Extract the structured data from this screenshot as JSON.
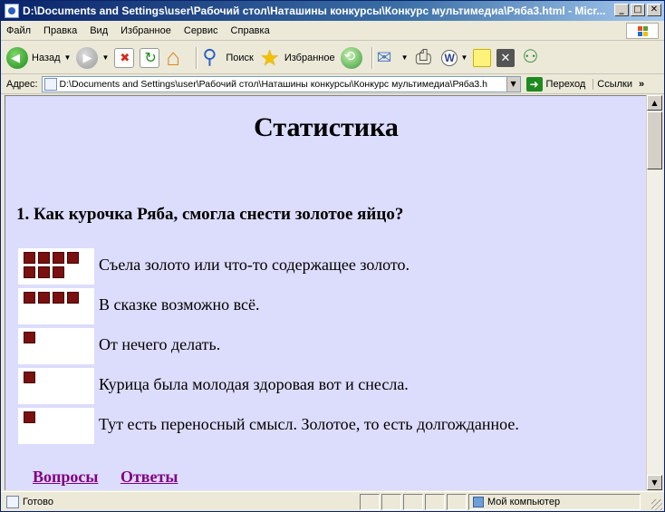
{
  "window": {
    "title": "D:\\Documents and Settings\\user\\Рабочий стол\\Наташины конкурсы\\Конкурс мультимедиа\\Ряба3.html - Micr...",
    "buttons": {
      "minimize": "_",
      "maximize": "□",
      "close": "✕"
    }
  },
  "menu": {
    "items": [
      "Файл",
      "Правка",
      "Вид",
      "Избранное",
      "Сервис",
      "Справка"
    ]
  },
  "toolbar": {
    "back_label": "Назад",
    "search_label": "Поиск",
    "favorites_label": "Избранное"
  },
  "address": {
    "label": "Адрес:",
    "url": "D:\\Documents and Settings\\user\\Рабочий стол\\Наташины конкурсы\\Конкурс мультимедиа\\Ряба3.h",
    "go_label": "Переход",
    "links_label": "Ссылки"
  },
  "page": {
    "heading": "Статистика",
    "question": "1. Как курочка Ряба, смогла снести золотое яйцо?",
    "answers": [
      {
        "text": "Съела золото или что-то содержащее золото.",
        "votes": 7
      },
      {
        "text": "В сказке возможно всё.",
        "votes": 4
      },
      {
        "text": "От нечего делать.",
        "votes": 1
      },
      {
        "text": "Курица была молодая здоровая вот и снесла.",
        "votes": 1
      },
      {
        "text": "Тут есть переносный смысл. Золотое, то есть долгожданное.",
        "votes": 1
      }
    ],
    "links": {
      "questions": "Вопросы",
      "answers": "Ответы"
    },
    "bar_color": "#7a1010",
    "background_color": "#dcdcfc"
  },
  "status": {
    "text": "Готово",
    "zone": "Мой компьютер"
  }
}
